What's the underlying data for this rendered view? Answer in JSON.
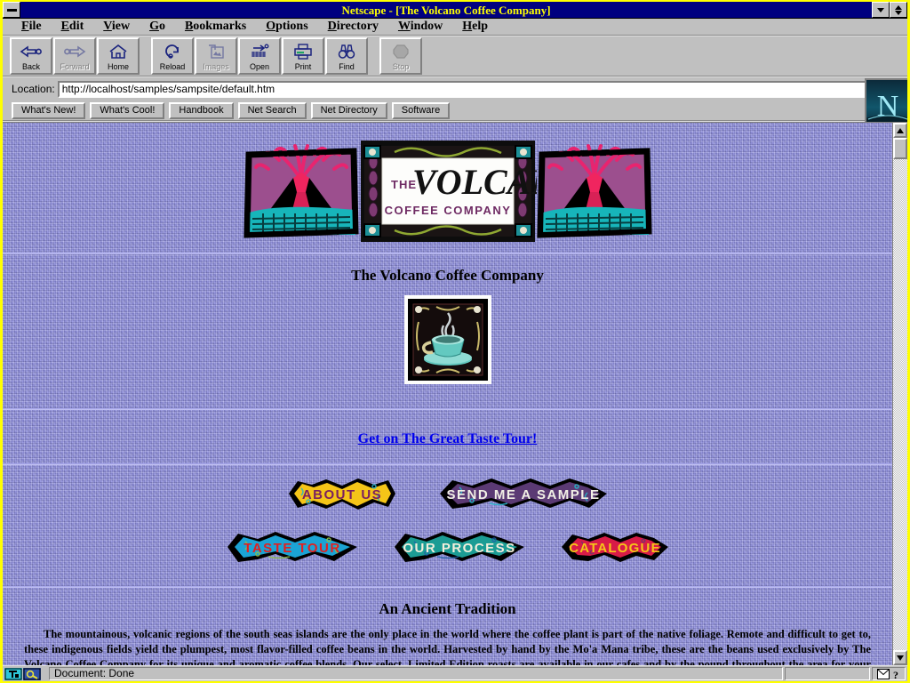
{
  "window": {
    "title": "Netscape - [The Volcano Coffee Company]",
    "minimize_label": "minimize",
    "restore_label": "restore"
  },
  "menubar": {
    "items": [
      {
        "label": "File",
        "accel": "F"
      },
      {
        "label": "Edit",
        "accel": "E"
      },
      {
        "label": "View",
        "accel": "V"
      },
      {
        "label": "Go",
        "accel": "G"
      },
      {
        "label": "Bookmarks",
        "accel": "B"
      },
      {
        "label": "Options",
        "accel": "O"
      },
      {
        "label": "Directory",
        "accel": "D"
      },
      {
        "label": "Window",
        "accel": "W"
      },
      {
        "label": "Help",
        "accel": "H"
      }
    ]
  },
  "toolbar": {
    "buttons": [
      {
        "label": "Back",
        "icon": "back-arrow-icon",
        "enabled": true
      },
      {
        "label": "Forward",
        "icon": "forward-arrow-icon",
        "enabled": false
      },
      {
        "label": "Home",
        "icon": "house-icon",
        "enabled": true
      },
      {
        "label": "Reload",
        "icon": "reload-icon",
        "enabled": true
      },
      {
        "label": "Images",
        "icon": "images-icon",
        "enabled": false
      },
      {
        "label": "Open",
        "icon": "open-icon",
        "enabled": true
      },
      {
        "label": "Print",
        "icon": "printer-icon",
        "enabled": true
      },
      {
        "label": "Find",
        "icon": "binoculars-icon",
        "enabled": true
      },
      {
        "label": "Stop",
        "icon": "stop-octagon-icon",
        "enabled": false
      }
    ]
  },
  "location": {
    "label": "Location:",
    "url": "http://localhost/samples/sampsite/default.htm",
    "dropdown_icon": "dropdown-arrow-icon"
  },
  "directory_bar": {
    "buttons": [
      "What's New!",
      "What's Cool!",
      "Handbook",
      "Net Search",
      "Net Directory",
      "Software"
    ]
  },
  "branding": {
    "logo_alt": "netscape-n-logo",
    "logo_letter": "N"
  },
  "page": {
    "banner": {
      "sign_line1": "THE",
      "sign_line2": "VOLCANO",
      "sign_line3": "COFFEE COMPANY",
      "left_image_alt": "volcano-illustration",
      "right_image_alt": "volcano-illustration"
    },
    "heading": "The Volcano Coffee Company",
    "cup_image_alt": "steaming-coffee-cup",
    "tour_link": "Get on The Great Taste Tour!",
    "nav_row1": [
      {
        "label": "ABOUT US",
        "bg": "#f5c518",
        "fg": "#7a2060",
        "shape": "burst"
      },
      {
        "label": "SEND ME A SAMPLE",
        "bg": "#5b3a74",
        "fg": "#f2f0e6",
        "shape": "burst"
      }
    ],
    "nav_row2": [
      {
        "label": "TASTE TOUR",
        "bg": "#1ba3d4",
        "fg": "#e02020",
        "shape": "burst"
      },
      {
        "label": "OUR PROCESS",
        "bg": "#1c9c94",
        "fg": "#f2efdc",
        "shape": "burst"
      },
      {
        "label": "CATALOGUE",
        "bg": "#d81b47",
        "fg": "#f5c518",
        "shape": "burst"
      }
    ],
    "section_heading": "An Ancient Tradition",
    "body_paragraph": "The mountainous, volcanic regions of the south seas islands are the only place in the world where the coffee plant is part of the native foliage. Remote and difficult to get to, these indigenous fields yield the plumpest, most flavor-filled coffee beans in the world. Harvested by hand by the Mo'a Mana tribe, these are the beans used exclusively by The Volcano Coffee Company for its unique and aromatic coffee blends. Our select, Limited Edition roasts are available in our cafes and by the pound throughout the area for your drinking pleasure."
  },
  "statusbar": {
    "text": "Document: Done",
    "left_icons": [
      "security-key-icon",
      "connection-icon"
    ],
    "right_icons": [
      "mail-icon",
      "help-icon"
    ]
  },
  "colors": {
    "titlebar": "#000080",
    "titlebar_text": "#ffff00",
    "window_border": "#ffff00",
    "chrome": "#c0c0c0",
    "page_bg": "#8e8ee0",
    "link": "#0000ee"
  }
}
